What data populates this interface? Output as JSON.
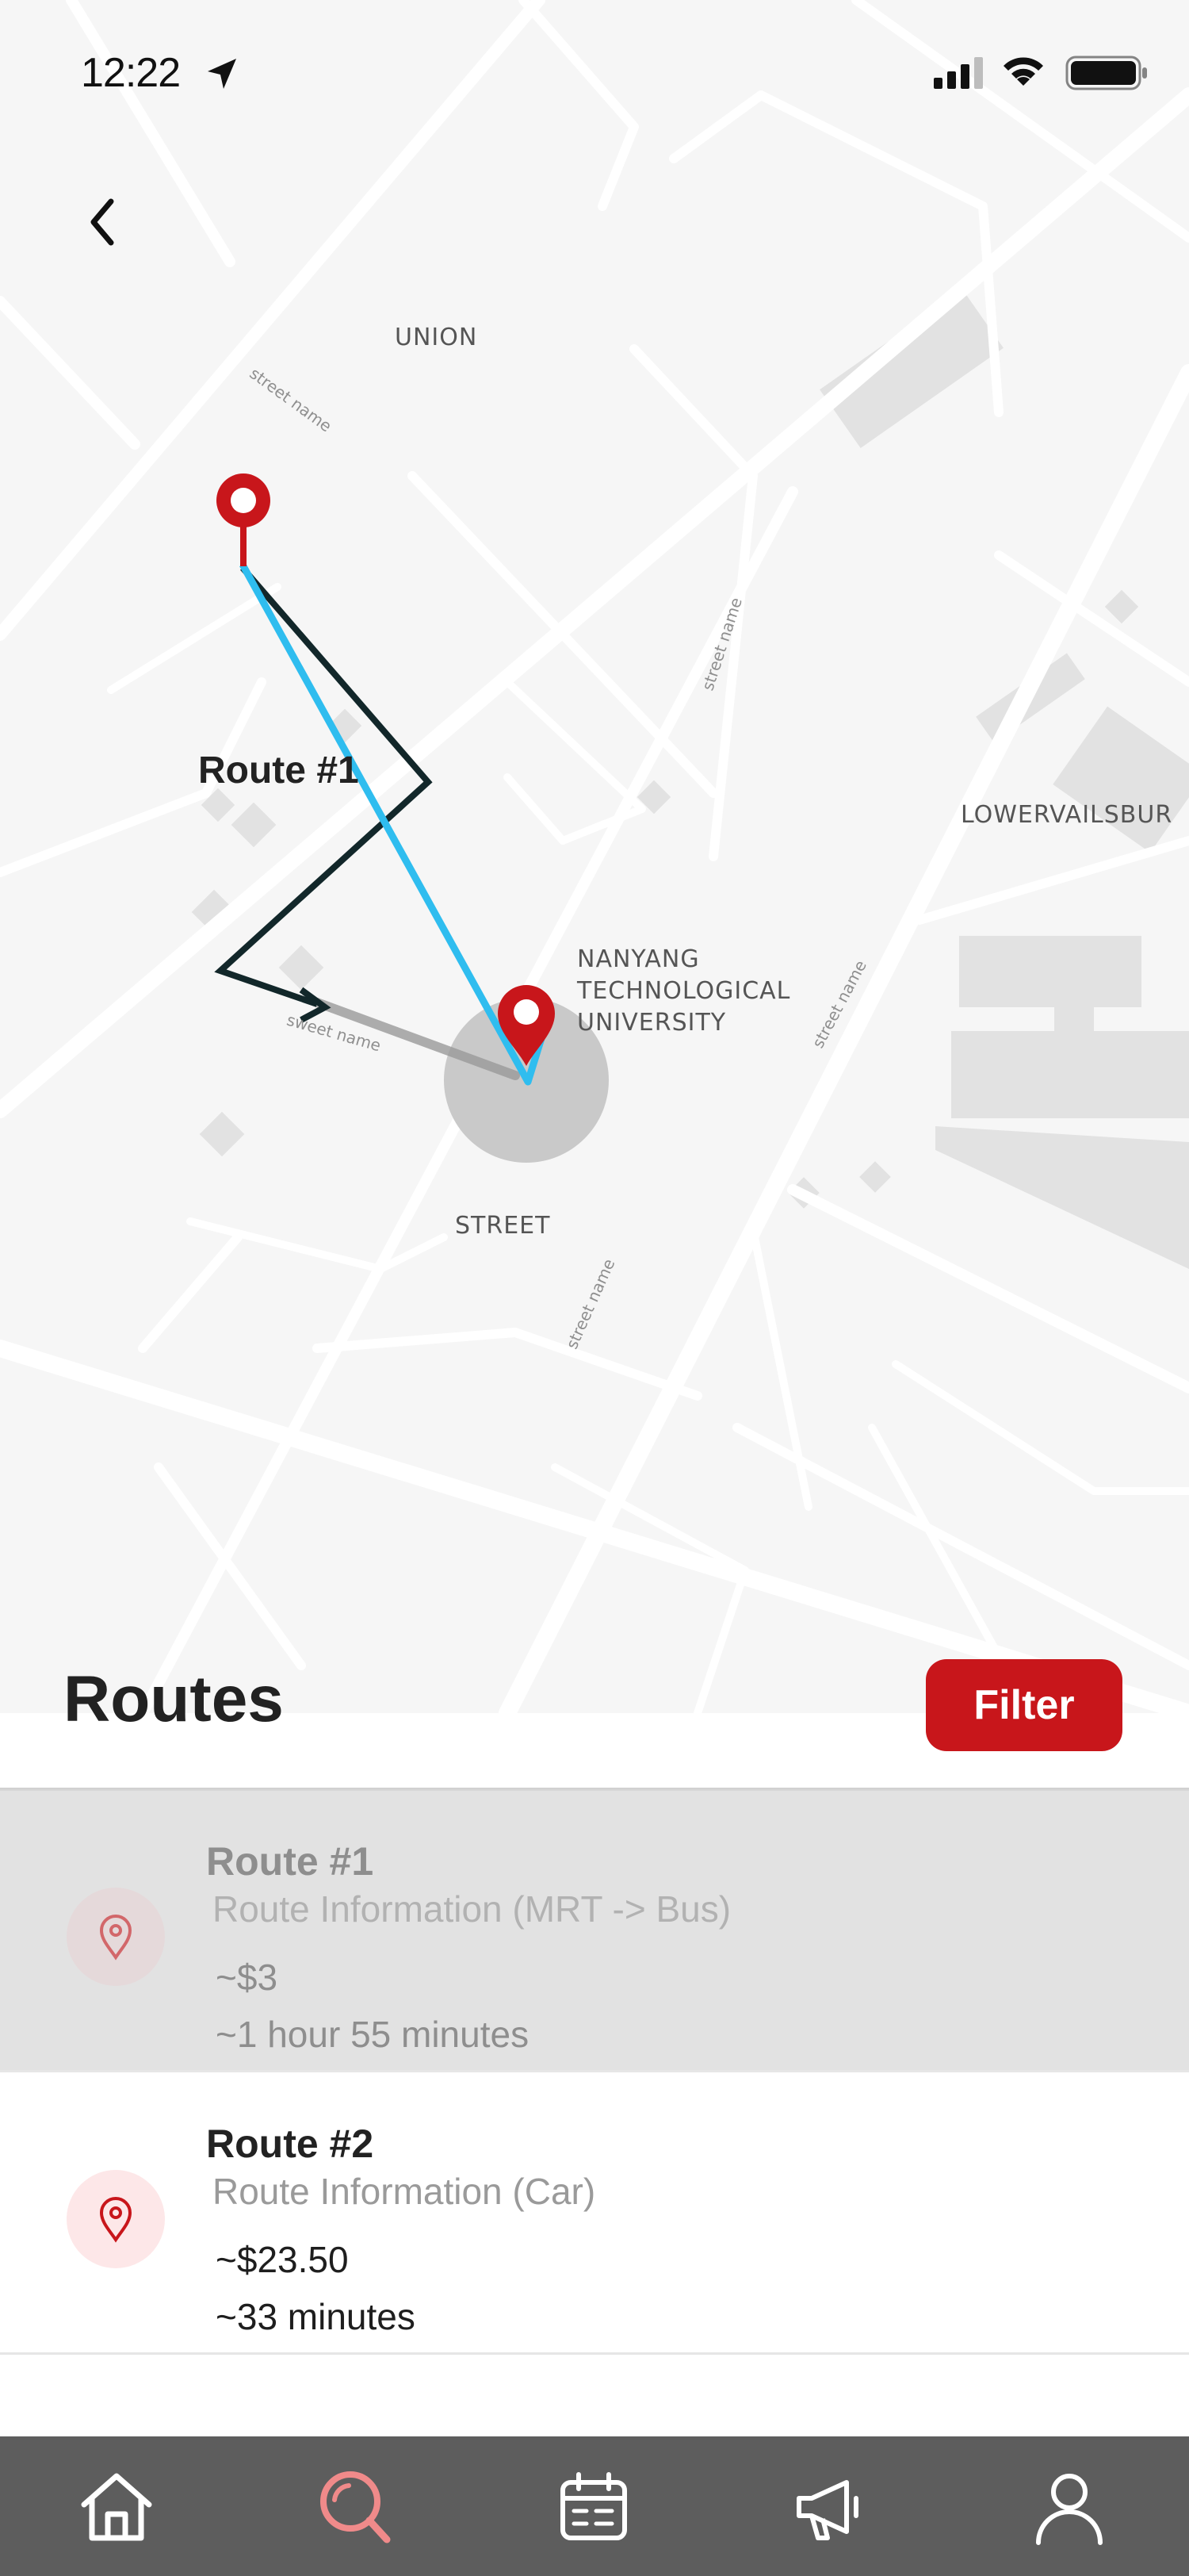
{
  "status_bar": {
    "time": "12:22",
    "icons": [
      "location-arrow-icon",
      "signal-icon",
      "wifi-icon",
      "battery-icon"
    ]
  },
  "navigation": {
    "back_icon": "chevron-left-icon"
  },
  "map": {
    "place_labels": {
      "union": "UNION",
      "lowervailsburg": "LOWERVAILSBUR",
      "nanyang": [
        "NANYANG",
        "TECHNOLOGICAL",
        "UNIVERSITY"
      ],
      "street": "STREET"
    },
    "street_labels": [
      "street name",
      "street name",
      "street name",
      "sweet name",
      "street name"
    ],
    "route_label": "Route #1",
    "colors": {
      "route_primary": "#2fbdef",
      "route_alternate": "#12272a",
      "pin": "#c8161b",
      "background": "#f6f6f6"
    }
  },
  "routes_sheet": {
    "title": "Routes",
    "filter_label": "Filter",
    "accent": "#c8161b",
    "items": [
      {
        "title": "Route #1",
        "info": "Route Information (MRT -> Bus)",
        "cost": "~$3",
        "duration": "~1 hour 55 minutes",
        "selected": true,
        "icon": "location-pin-icon"
      },
      {
        "title": "Route #2",
        "info": "Route Information (Car)",
        "cost": "~$23.50",
        "duration": "~33 minutes",
        "selected": false,
        "icon": "location-pin-icon"
      }
    ]
  },
  "tab_bar": {
    "background": "#5d5d5d",
    "active_color": "#f08a8a",
    "tabs": [
      {
        "icon": "home-icon",
        "active": false
      },
      {
        "icon": "search-icon",
        "active": true
      },
      {
        "icon": "calendar-icon",
        "active": false
      },
      {
        "icon": "megaphone-icon",
        "active": false
      },
      {
        "icon": "profile-icon",
        "active": false
      }
    ]
  }
}
